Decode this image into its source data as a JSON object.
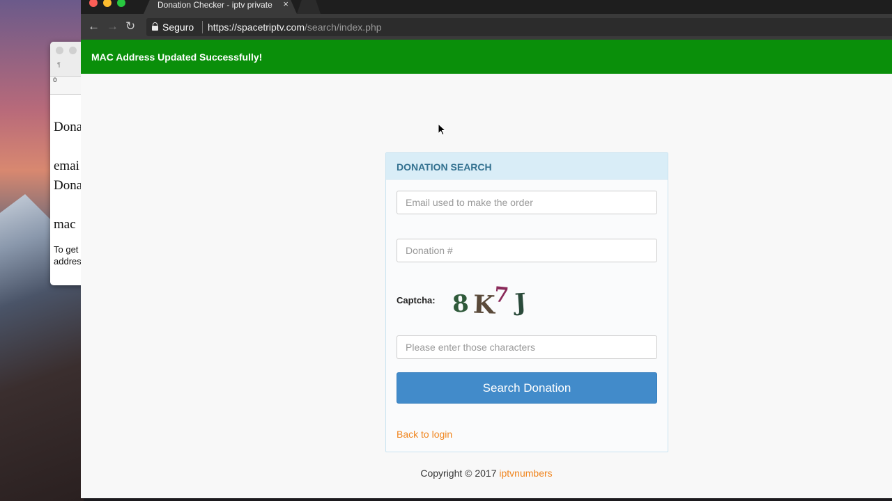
{
  "background_doc": {
    "lines": [
      "Dona",
      "emai",
      "Dona",
      "mac",
      "To get",
      "addres"
    ],
    "ruler_mark": "0",
    "para_mark": "¶"
  },
  "browser": {
    "tab": {
      "title": "Donation Checker - iptv private",
      "close": "×"
    },
    "nav": {
      "back": "←",
      "forward": "→",
      "reload": "↻"
    },
    "address": {
      "secure_label": "Seguro",
      "url_host": "https://spacetriptv.com",
      "url_path": "/search/index.php"
    }
  },
  "alert": {
    "message": "MAC Address Updated Successfully!",
    "color": "#0a8f0a"
  },
  "form": {
    "title": "DONATION SEARCH",
    "email": {
      "placeholder": "Email used to make the order",
      "value": ""
    },
    "donation": {
      "placeholder": "Donation #",
      "value": ""
    },
    "captcha": {
      "label": "Captcha:",
      "characters": [
        "8",
        "K",
        "7",
        "J"
      ],
      "input_placeholder": "Please enter those characters"
    },
    "submit_label": "Search Donation",
    "back_link": "Back to login"
  },
  "footer": {
    "text": "Copyright © 2017",
    "link": "iptvnumbers"
  },
  "colors": {
    "primary": "#428bca",
    "link": "#f0851e",
    "panel_heading": "#31708f"
  }
}
